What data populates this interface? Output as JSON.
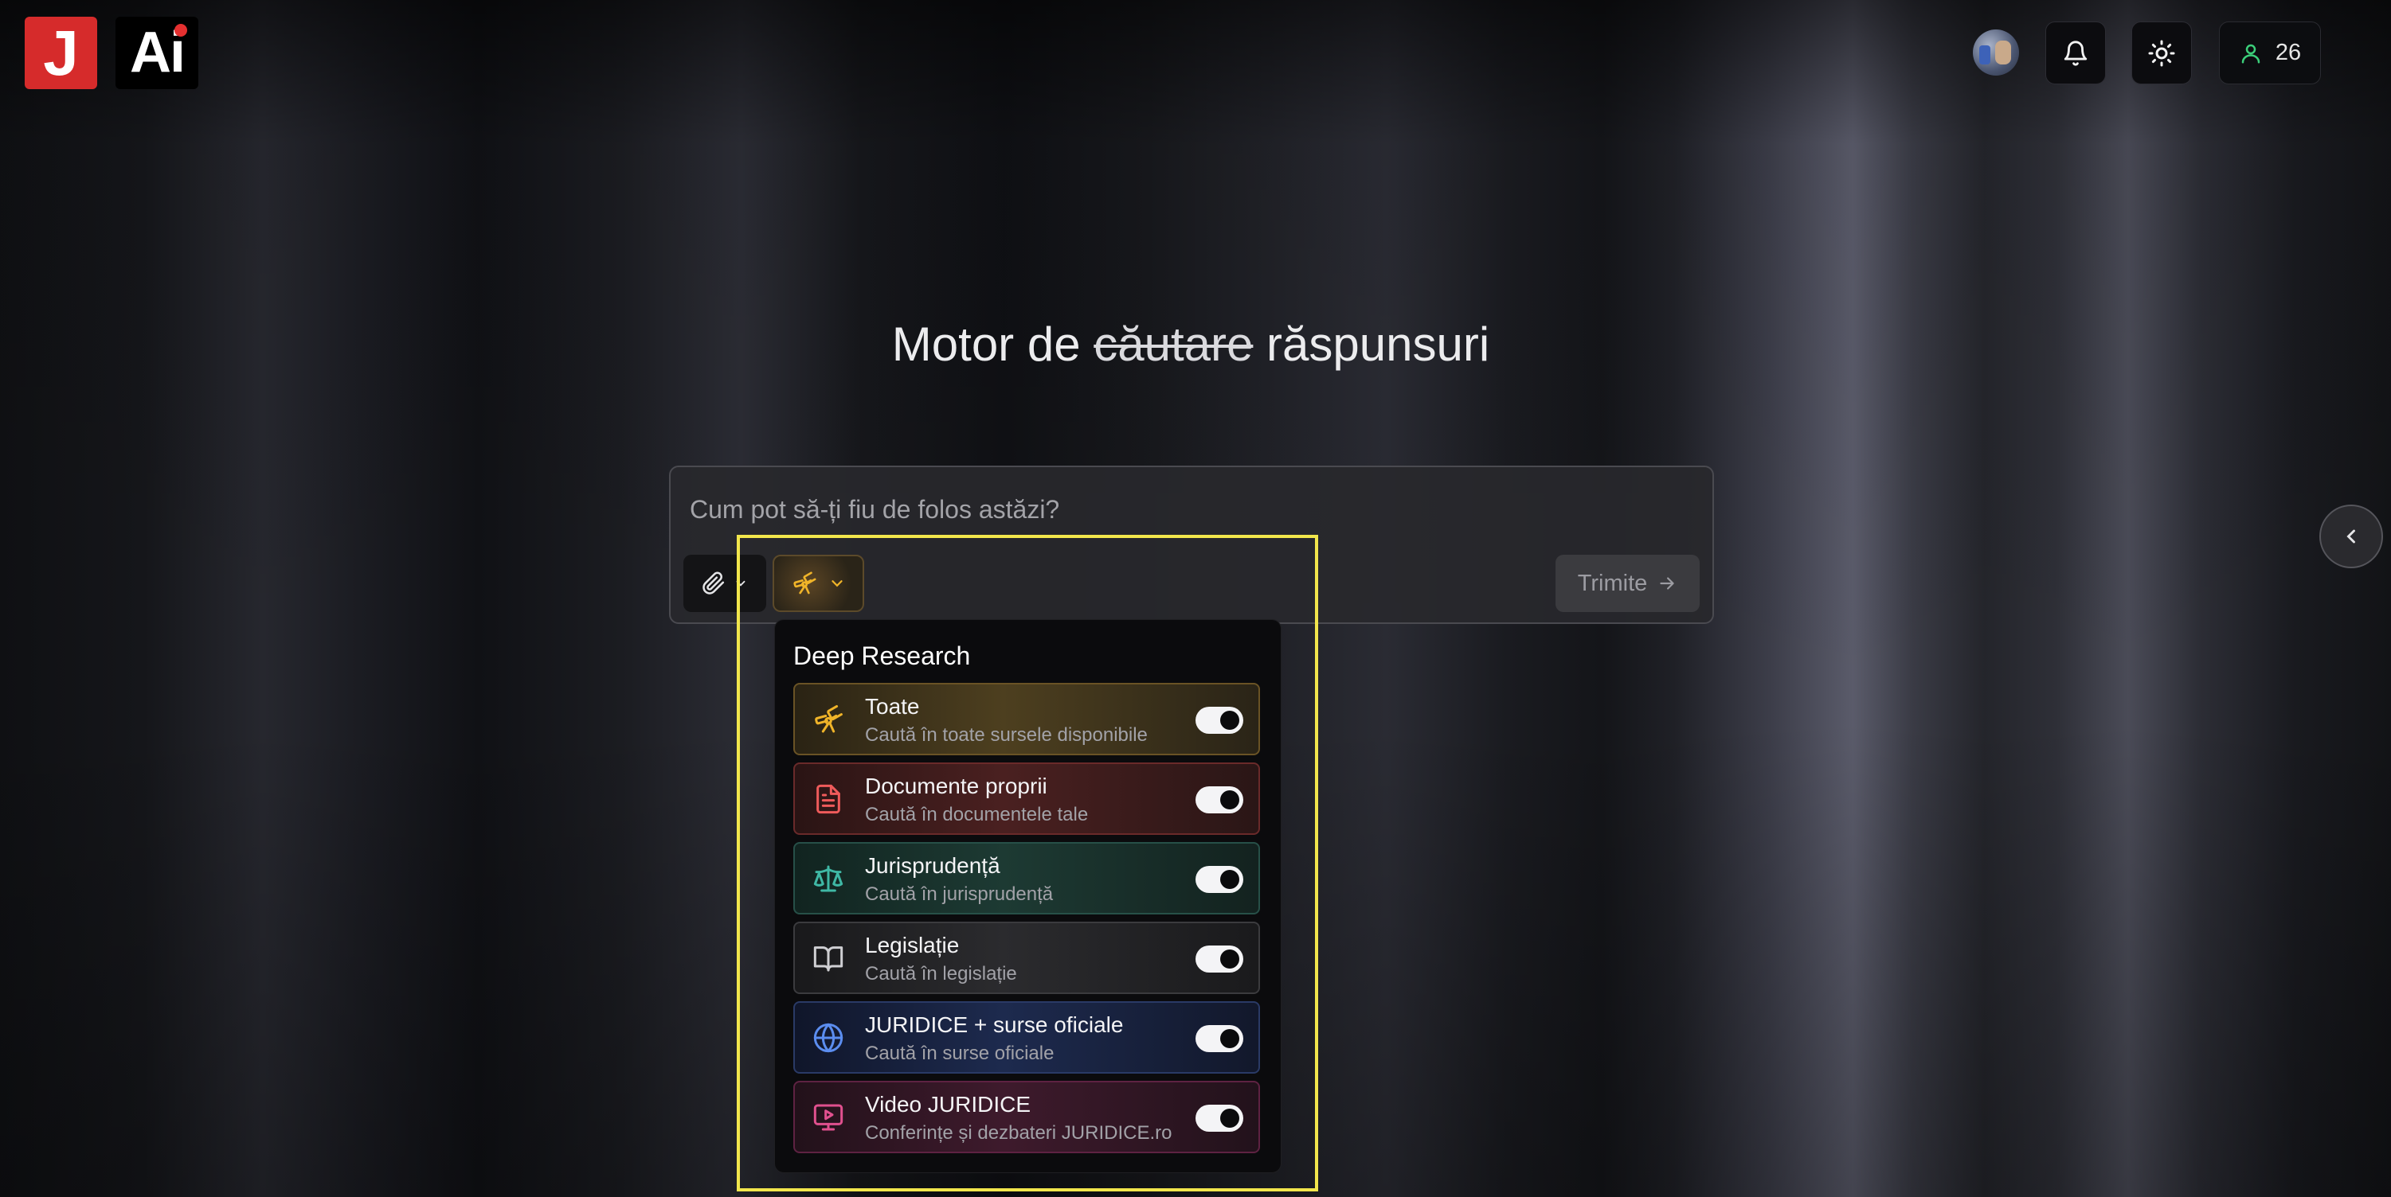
{
  "logo": {
    "letter": "J",
    "ai_text": "Ai"
  },
  "header": {
    "notifications_icon": "bell-icon",
    "theme_icon": "sun-icon",
    "user_count": "26"
  },
  "hero": {
    "prefix": "Motor de ",
    "strikethrough": "căutare",
    "suffix": " răspunsuri"
  },
  "search": {
    "placeholder": "Cum pot să-ți fiu de folos astăzi?",
    "send_label": "Trimite"
  },
  "deep_research": {
    "title": "Deep Research",
    "options": [
      {
        "title": "Toate",
        "subtitle": "Caută în toate sursele disponibile",
        "enabled": true,
        "icon": "telescope-icon",
        "color": "#f0b429"
      },
      {
        "title": "Documente proprii",
        "subtitle": "Caută în documentele tale",
        "enabled": true,
        "icon": "document-icon",
        "color": "#ef5b5b"
      },
      {
        "title": "Jurisprudență",
        "subtitle": "Caută în jurisprudență",
        "enabled": true,
        "icon": "scales-icon",
        "color": "#3fb8a5"
      },
      {
        "title": "Legislație",
        "subtitle": "Caută în legislație",
        "enabled": true,
        "icon": "book-icon",
        "color": "#cfcfd3"
      },
      {
        "title": "JURIDICE + surse oficiale",
        "subtitle": "Caută în surse oficiale",
        "enabled": true,
        "icon": "globe-icon",
        "color": "#5b8def"
      },
      {
        "title": "Video JURIDICE",
        "subtitle": "Conferințe și dezbateri JURIDICE.ro",
        "enabled": true,
        "icon": "video-icon",
        "color": "#e0508e"
      }
    ]
  },
  "colors": {
    "accent_red": "#d62b2b",
    "highlight": "#f2e64c",
    "user_icon": "#3ccf7a"
  }
}
